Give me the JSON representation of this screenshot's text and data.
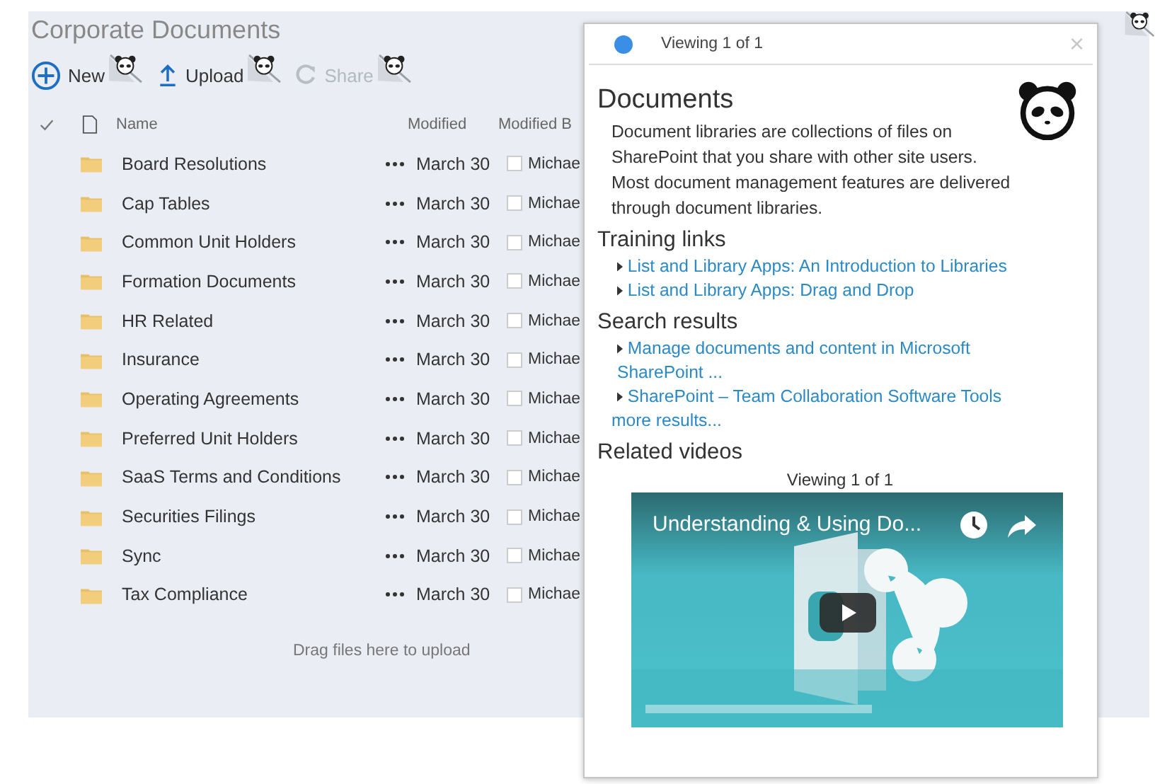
{
  "library": {
    "title": "Corporate Documents",
    "toolbar": [
      {
        "label": "New",
        "kind": "new",
        "disabled": false
      },
      {
        "label": "Upload",
        "kind": "upload",
        "disabled": false
      },
      {
        "label": "Share",
        "kind": "share",
        "disabled": true
      }
    ],
    "columns": [
      {
        "label": "Name"
      },
      {
        "label": "Modified"
      },
      {
        "label": "Modified B"
      }
    ],
    "rows": [
      {
        "name": "Board Resolutions",
        "modified": "March 30",
        "checked": false,
        "modified_by": "Michae"
      },
      {
        "name": "Cap Tables",
        "modified": "March 30",
        "checked": false,
        "modified_by": "Michae"
      },
      {
        "name": "Common Unit Holders",
        "modified": "March 30",
        "checked": false,
        "modified_by": "Michae"
      },
      {
        "name": "Formation Documents",
        "modified": "March 30",
        "checked": false,
        "modified_by": "Michae"
      },
      {
        "name": "HR Related",
        "modified": "March 30",
        "checked": false,
        "modified_by": "Michae"
      },
      {
        "name": "Insurance",
        "modified": "March 30",
        "checked": false,
        "modified_by": "Michae"
      },
      {
        "name": "Operating Agreements",
        "modified": "March 30",
        "checked": false,
        "modified_by": "Michae"
      },
      {
        "name": "Preferred Unit Holders",
        "modified": "March 30",
        "checked": false,
        "modified_by": "Michae"
      },
      {
        "name": "SaaS Terms and Conditions",
        "modified": "March 30",
        "checked": false,
        "modified_by": "Michae"
      },
      {
        "name": "Securities Filings",
        "modified": "March 30",
        "checked": false,
        "modified_by": "Michae"
      },
      {
        "name": "Sync",
        "modified": "March 30",
        "checked": false,
        "modified_by": "Michae"
      },
      {
        "name": "Tax Compliance",
        "modified": "March 30",
        "checked": false,
        "modified_by": "Michae"
      }
    ],
    "drop_hint": "Drag files here to upload"
  },
  "help_panel": {
    "pager": "Viewing 1 of 1",
    "close": "×",
    "title": "Documents",
    "description": "Document libraries are collections of files on SharePoint that you share with other site users. Most document management features are delivered through document libraries.",
    "sections": [
      {
        "heading": "Training links",
        "links": [
          "List and Library Apps: An Introduction to Libraries",
          "List and Library Apps: Drag and Drop"
        ]
      },
      {
        "heading": "Search results",
        "links": [
          "Manage documents and content in Microsoft SharePoint ...",
          "SharePoint – Team Collaboration Software Tools"
        ],
        "more": "more results..."
      }
    ],
    "videos": {
      "heading": "Related videos",
      "pager": "Viewing 1 of 1",
      "video_title": "Understanding & Using Do..."
    }
  }
}
